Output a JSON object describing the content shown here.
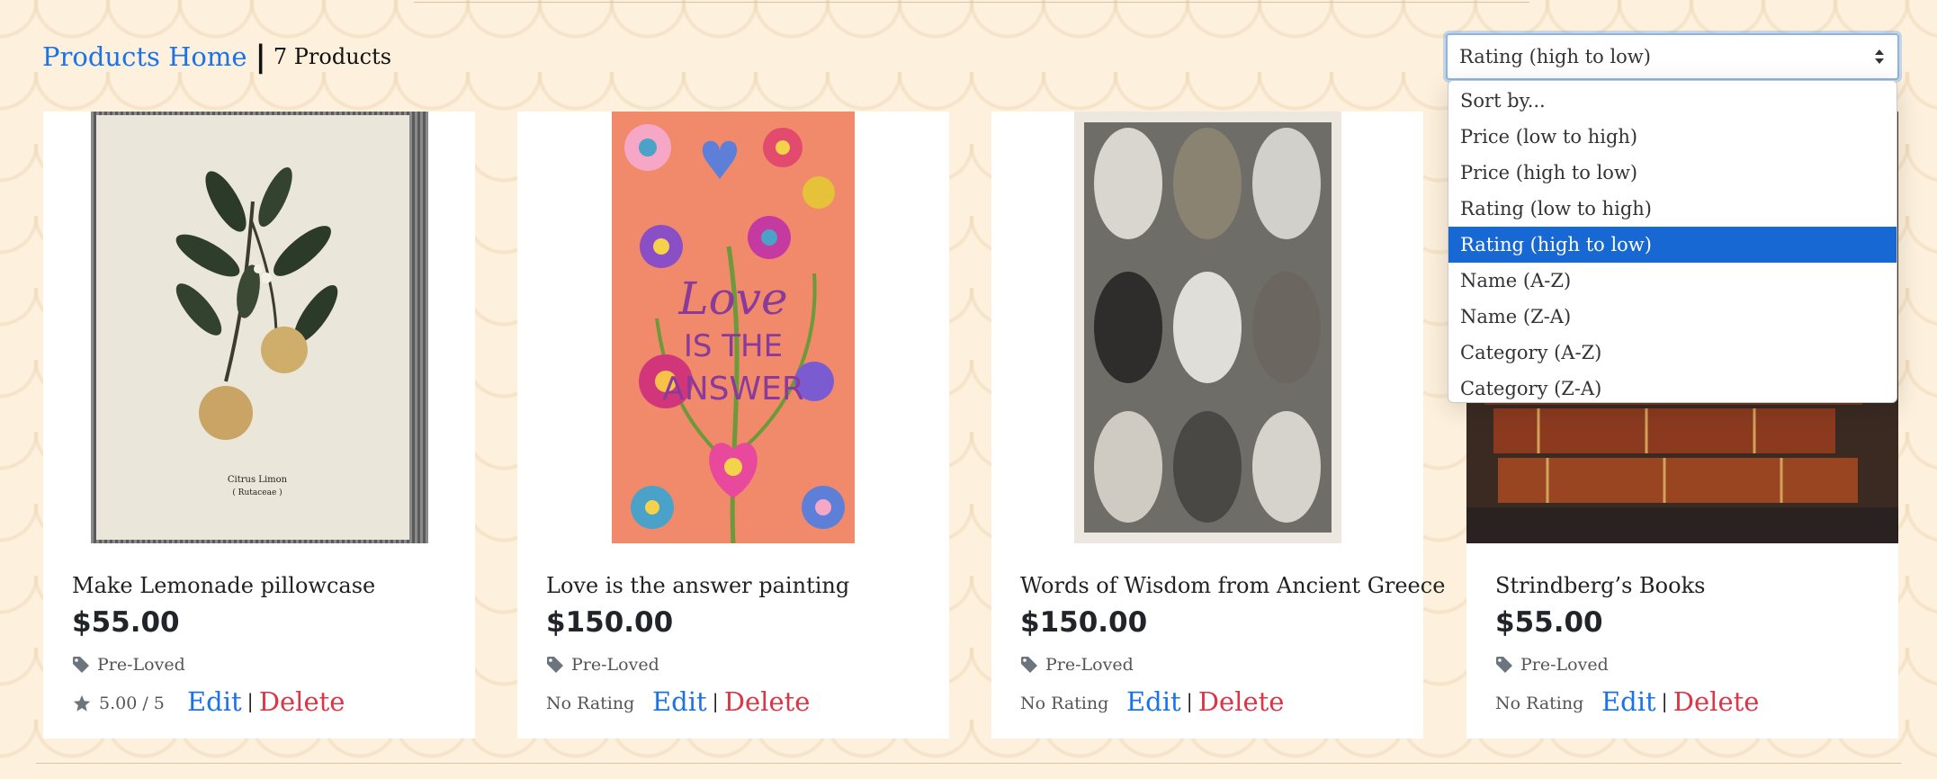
{
  "header": {
    "home_label": "Products Home",
    "separator": "|",
    "count_label": "7 Products"
  },
  "sort": {
    "selected": "Rating (high to low)",
    "options": [
      "Sort by...",
      "Price (low to high)",
      "Price (high to low)",
      "Rating (low to high)",
      "Rating (high to low)",
      "Name (A-Z)",
      "Name (Z-A)",
      "Category (A-Z)",
      "Category (Z-A)"
    ]
  },
  "products": [
    {
      "title": "Make Lemonade pillowcase",
      "price": "$55.00",
      "category": "Pre-Loved",
      "rating": "5.00 / 5",
      "image_text_1": "Citrus Limon",
      "image_text_2": "( Rutaceae )"
    },
    {
      "title": "Love is the answer painting",
      "price": "$150.00",
      "category": "Pre-Loved",
      "rating": "No Rating",
      "image_text_1": "Love",
      "image_text_2": "IS THE",
      "image_text_3": "ANSWER"
    },
    {
      "title": "Words of Wisdom from Ancient Greece",
      "price": "$150.00",
      "category": "Pre-Loved",
      "rating": "No Rating"
    },
    {
      "title": "Strindberg’s Books",
      "price": "$55.00",
      "category": "Pre-Loved",
      "rating": "No Rating"
    }
  ],
  "actions": {
    "edit": "Edit",
    "pipe": "|",
    "delete": "Delete"
  },
  "colors": {
    "link": "#1a73e8",
    "danger": "#dc3545",
    "selected_option": "#1868d4",
    "background": "#fdf0dc"
  }
}
